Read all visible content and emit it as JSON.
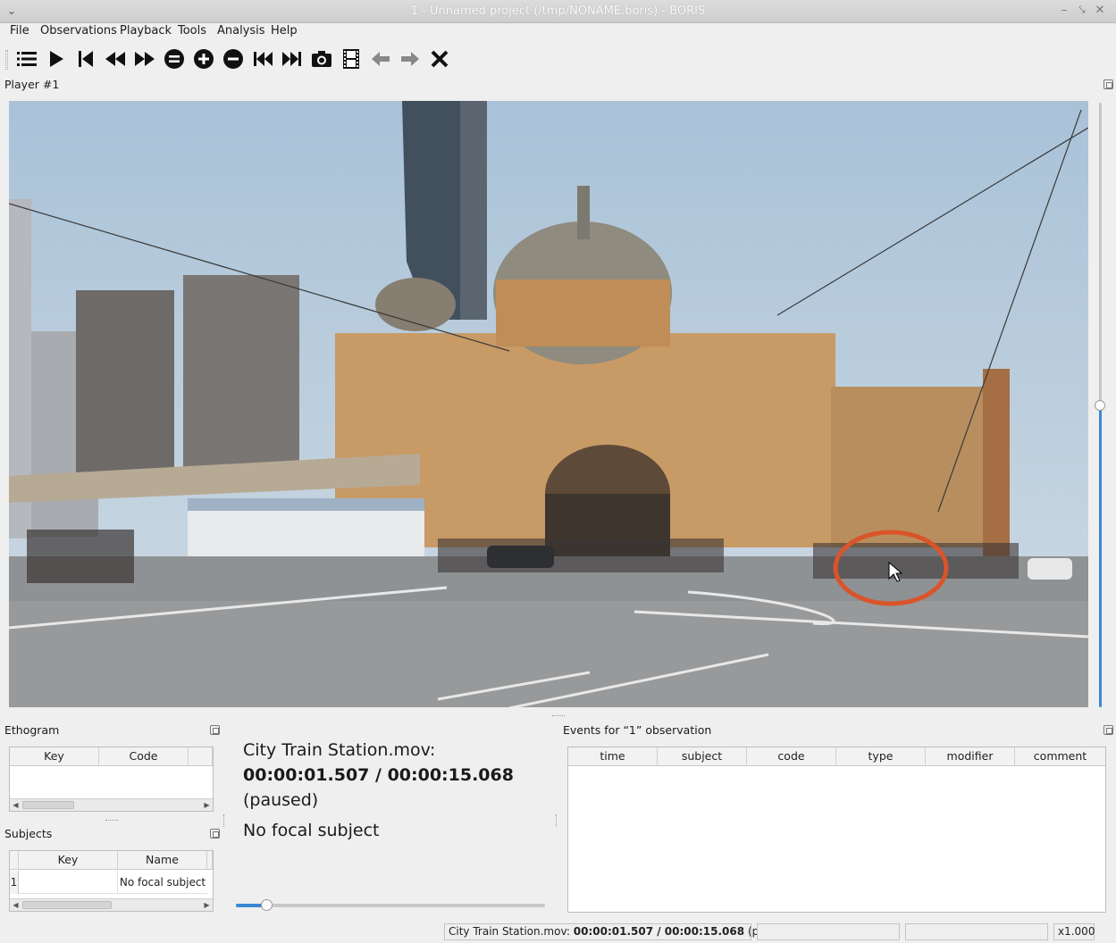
{
  "window": {
    "title": "1 - Unnamed project (/tmp/NONAME.boris) - BORIS"
  },
  "menu": [
    "File",
    "Observations",
    "Playback",
    "Tools",
    "Analysis",
    "Help"
  ],
  "toolbar": {
    "icons": [
      "list-icon",
      "play-icon",
      "jump-start-icon",
      "rewind-icon",
      "fast-forward-icon",
      "reset-speed-icon",
      "speed-up-icon",
      "slow-down-icon",
      "previous-media-icon",
      "next-media-icon",
      "snapshot-icon",
      "frame-by-frame-icon",
      "frame-backward-icon",
      "frame-forward-icon",
      "close-observation-icon"
    ]
  },
  "player": {
    "title": "Player #1",
    "volume_fraction": 0.5
  },
  "ethogram": {
    "title": "Ethogram",
    "columns": [
      "Key",
      "Code"
    ]
  },
  "subjects": {
    "title": "Subjects",
    "columns": [
      "Key",
      "Name"
    ],
    "rows": [
      {
        "index": "1",
        "key": "",
        "name": "No focal subject"
      }
    ]
  },
  "info": {
    "media": "City Train Station.mov:",
    "time": "00:00:01.507 / 00:00:15.068",
    "state": "(paused)",
    "focal": "No focal subject",
    "position_fraction": 0.1
  },
  "events": {
    "title": "Events for “1” observation",
    "columns": [
      "time",
      "subject",
      "code",
      "type",
      "modifier",
      "comment"
    ]
  },
  "statusbar": {
    "media": "City Train Station.mov:",
    "time": "00:00:01.507 / 00:00:15.068",
    "state": "(paused)",
    "speed": "x1.000"
  },
  "colors": {
    "accent": "#3a87d6",
    "annotation": "#d9542a"
  }
}
